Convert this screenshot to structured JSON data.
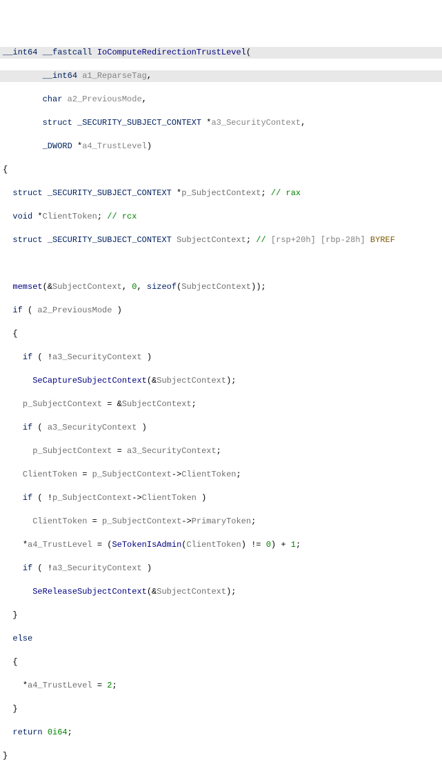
{
  "code": {
    "sig_ret": "__int64",
    "sig_cc": "__fastcall",
    "sig_name": "IoComputeRedirectionTrustLevel",
    "p1_type": "__int64",
    "p1_name": "a1_ReparseTag",
    "p2_type": "char",
    "p2_name": "a2_PreviousMode",
    "p3_type": "struct",
    "p3_struct": "_SECURITY_SUBJECT_CONTEXT",
    "p3_name": "a3_SecurityContext",
    "p4_type": "_DWORD",
    "p4_name": "a4_TrustLevel",
    "loc1_type": "struct",
    "loc1_struct": "_SECURITY_SUBJECT_CONTEXT",
    "loc1_name": "p_SubjectContext",
    "loc1_comment": "// rax",
    "loc2_type": "void",
    "loc2_name": "ClientToken",
    "loc2_comment": "// rcx",
    "loc3_type": "struct",
    "loc3_struct": "_SECURITY_SUBJECT_CONTEXT",
    "loc3_name": "SubjectContext",
    "loc3_comment": "// ",
    "loc3_frame": "[rsp+20h] [rbp-28h]",
    "loc3_byref": " BYREF",
    "call_memset": "memset",
    "ref_subj": "SubjectContext",
    "num0": "0",
    "kw_sizeof": "sizeof",
    "kw_if": "if",
    "kw_else": "else",
    "kw_return": "return",
    "ref_prev": "a2_PreviousMode",
    "ref_sec": "a3_SecurityContext",
    "call_capture": "SeCaptureSubjectContext",
    "ref_psubj": "p_SubjectContext",
    "ref_ctoken": "ClientToken",
    "fld_client": "ClientToken",
    "fld_primary": "PrimaryToken",
    "ref_trust": "a4_TrustLevel",
    "call_isadmin": "SeTokenIsAdmin",
    "num1": "1",
    "num2": "2",
    "call_release": "SeReleaseSubjectContext",
    "ret_val": "0i64"
  }
}
